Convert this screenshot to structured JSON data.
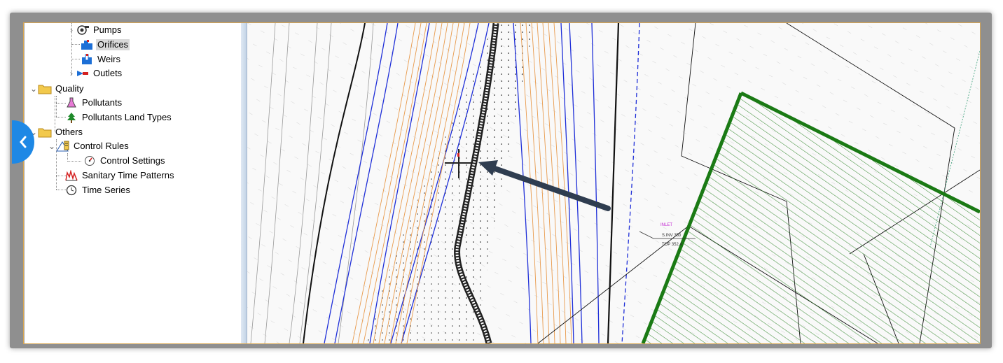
{
  "tree": {
    "items": [
      {
        "label": "Pumps",
        "icon": "pump-icon"
      },
      {
        "label": "Orifices",
        "icon": "orifice-icon"
      },
      {
        "label": "Weirs",
        "icon": "weir-icon"
      },
      {
        "label": "Outlets",
        "icon": "outlet-icon"
      },
      {
        "label": "Quality",
        "icon": "folder-icon"
      },
      {
        "label": "Pollutants",
        "icon": "flask-icon"
      },
      {
        "label": "Pollutants Land Types",
        "icon": "tree-icon"
      },
      {
        "label": "Others",
        "icon": "folder-icon"
      },
      {
        "label": "Control Rules",
        "icon": "control-rules-icon"
      },
      {
        "label": "Control Settings",
        "icon": "gauge-icon"
      },
      {
        "label": "Sanitary Time Patterns",
        "icon": "pattern-icon"
      },
      {
        "label": "Time Series",
        "icon": "clock-icon"
      }
    ]
  },
  "map": {
    "annotation_inlet": "INLET",
    "annotation_inv": "S.INV 350",
    "annotation_top": "TOP 352.4",
    "colors": {
      "contour_blue": "#1f2fd8",
      "contour_orange": "#e89a4c",
      "boundary_green": "#1a7a14",
      "arrow": "#2f3d50",
      "tab_blue": "#1e88e5"
    }
  }
}
